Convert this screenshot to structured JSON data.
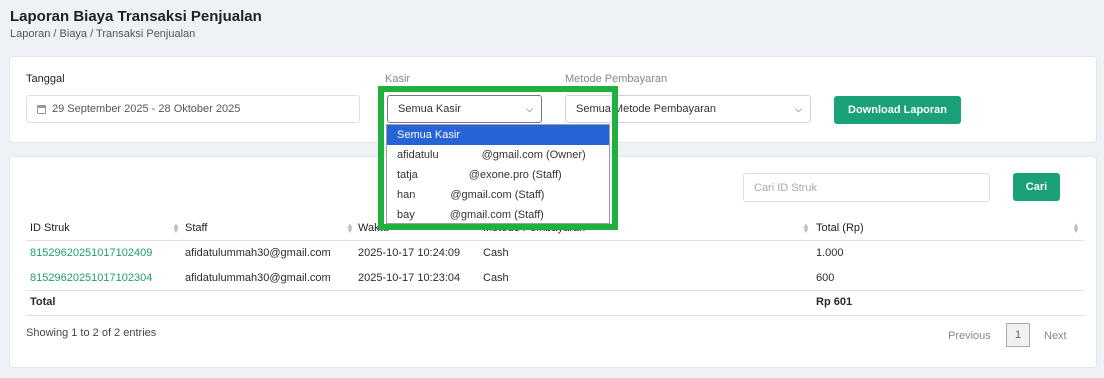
{
  "header": {
    "title": "Laporan Biaya Transaksi Penjualan",
    "breadcrumb": "Laporan / Biaya / Transaksi Penjualan"
  },
  "filters": {
    "tanggal_label": "Tanggal",
    "tanggal_value": "29 September 2025 - 28 Oktober 2025",
    "kasir_label": "Kasir",
    "kasir_value": "Semua Kasir",
    "metode_label": "Metode Pembayaran",
    "metode_value": "Semua Metode Pembayaran",
    "download_label": "Download Laporan"
  },
  "kasir_dropdown": {
    "options": [
      {
        "visible_start": "Semua Kasir",
        "visible_end": ""
      },
      {
        "visible_start": "afidatulu",
        "visible_end": "@gmail.com (Owner)"
      },
      {
        "visible_start": "tatja",
        "visible_end": "@exone.pro (Staff)"
      },
      {
        "visible_start": "han",
        "visible_end": "@gmail.com (Staff)"
      },
      {
        "visible_start": "bay",
        "visible_end": "@gmail.com (Staff)"
      }
    ]
  },
  "search": {
    "placeholder": "Cari ID Struk",
    "button_label": "Cari"
  },
  "table": {
    "columns": [
      "ID Struk",
      "Staff",
      "Waktu",
      "Metode Pembayaran",
      "Total (Rp)"
    ],
    "rows": [
      {
        "id": "81529620251017102409",
        "staff": "afidatulummah30@gmail.com",
        "waktu": "2025-10-17 10:24:09",
        "metode": "Cash",
        "total": "1.000"
      },
      {
        "id": "81529620251017102304",
        "staff": "afidatulummah30@gmail.com",
        "waktu": "2025-10-17 10:23:04",
        "metode": "Cash",
        "total": "600"
      }
    ],
    "total_label": "Total",
    "total_value": "Rp 601"
  },
  "pagination": {
    "info": "Showing 1 to 2 of 2 entries",
    "previous": "Previous",
    "current_page": "1",
    "next": "Next"
  },
  "colors": {
    "accent": "#1aa179",
    "highlight": "#1fb040",
    "dropdown_selected": "#2563d6"
  }
}
